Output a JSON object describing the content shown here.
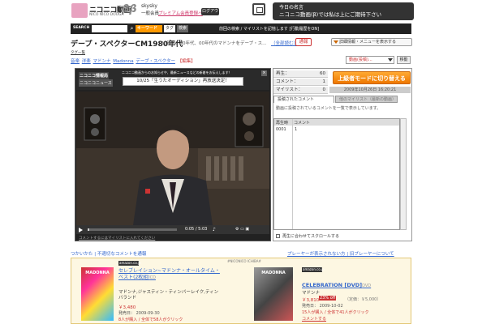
{
  "header": {
    "logo_text": "ニコニコ動画",
    "logo_sub": "NICO NICO DOUGA",
    "logo_beta": "ββ",
    "user_name": "skysky",
    "user_rank": "一般会員",
    "premium_link": "プレミアム会員登録へ",
    "logout_label": "ログアウト",
    "news_title": "今日の名言",
    "news_text": "ニコニコ動画(β)では私は上にご期待下さい"
  },
  "search": {
    "label": "SEARCH",
    "input_value": "",
    "keyword_label": "キーワード",
    "tag_label": "タグ",
    "button_label": "検索",
    "links": "前回の検索 / マイリストを記憶します [行動履歴をON]"
  },
  "video": {
    "title": "デープ・スペクターCM1980年代",
    "description": "80年代、90年代、00年代のマドンナをデープ・ス...",
    "more_link": "（全部読む）",
    "report_label": "通報",
    "detail_button": "詳細情報・メニューを表示する"
  },
  "tags": {
    "row_label": "タグ一覧",
    "items": [
      "音楽",
      "洋楽",
      "マドンナ",
      "Madonna",
      "デーブ・スペクター"
    ],
    "edit_label": "【編集】"
  },
  "nav_select": {
    "value": "動画(投稿)...",
    "move_label": "移動"
  },
  "player": {
    "logo1": "ニコニコ情報局",
    "logo2": "ニコニコニュース",
    "news_header": "ニコニコ動画からのお知らせや、最新ニュースなどの新着をお伝えします！",
    "news_headline": "10/25「生うたオーディション」再放送決定！",
    "close_icon": "×",
    "progress": 0.02,
    "time_text": "0:05 / 5:03",
    "ctrl_text": "⚙ ▭ ▣",
    "below_text": "コメントするにはマイリストに入れてください"
  },
  "stats": {
    "views_label": "再生：",
    "views_value": "60",
    "comments_label": "コメント：",
    "comments_value": "1",
    "mylist_label": "マイリスト：",
    "mylist_value": "0",
    "date": "2009年10月26日 16:20:21",
    "switch_button": "上級者モードに切り替える"
  },
  "comments": {
    "tab1": "投稿されたコメント",
    "tab2": "他のマイリスト（最新の動画）",
    "note": "動画に投稿されているコメントを一覧で表示しています。",
    "headers": [
      "再生時",
      "コメント"
    ],
    "rows": [
      [
        "0001",
        "1"
      ]
    ],
    "scroll_check": "再生に合わせてスクロールする"
  },
  "below_links": {
    "left": "つかいかた | 不適切なコメントを通報",
    "right": "プレーヤーが表示されない方 | 旧プレーヤーについて"
  },
  "amazon": {
    "header": "#NICONICO ICHIBA#",
    "logo": "amazon.co.jp",
    "products": [
      {
        "cover": "MADONNA",
        "title": "セレブレイション~マドンナ・オールタイム・ベスト(2枚組)",
        "format": "CD",
        "artist": "マドンナ,ジャスティン・ティンバーレイク,ティンバランド",
        "price": "￥3,480",
        "date": "発売日： 2009-09-30",
        "click": "8人が購入 / 全体で58人がクリック"
      },
      {
        "cover": "MADONNA",
        "title": "CELEBRATION [DVD]",
        "format": "DVD",
        "artist": "マドンナ",
        "price": "￥3,810",
        "off": "23% off",
        "orig": "（定価：￥5,000）",
        "date": "発売日： 2009-10-02",
        "click": "15人が購入 / 全体で41人がクリック",
        "comment": "コメントする"
      }
    ]
  }
}
